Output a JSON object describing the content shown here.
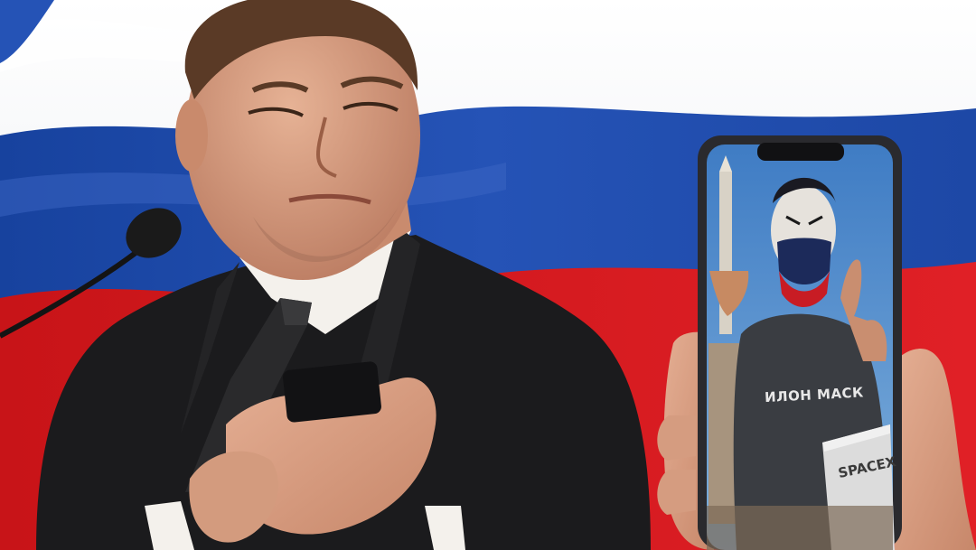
{
  "photo": {
    "shirt_text": "ИЛОН МАСК",
    "box_text": "SPACEX"
  },
  "colors": {
    "flag_white": "#f2f2f2",
    "flag_blue": "#1c48a8",
    "flag_red": "#d4161c",
    "suit": "#1b1b1d",
    "shirt": "#f4f1ec",
    "tie": "#2a2a2c",
    "skin": "#d9a184",
    "phone_frame": "#2a2a2e",
    "phone_sky": "#4a86c8"
  }
}
